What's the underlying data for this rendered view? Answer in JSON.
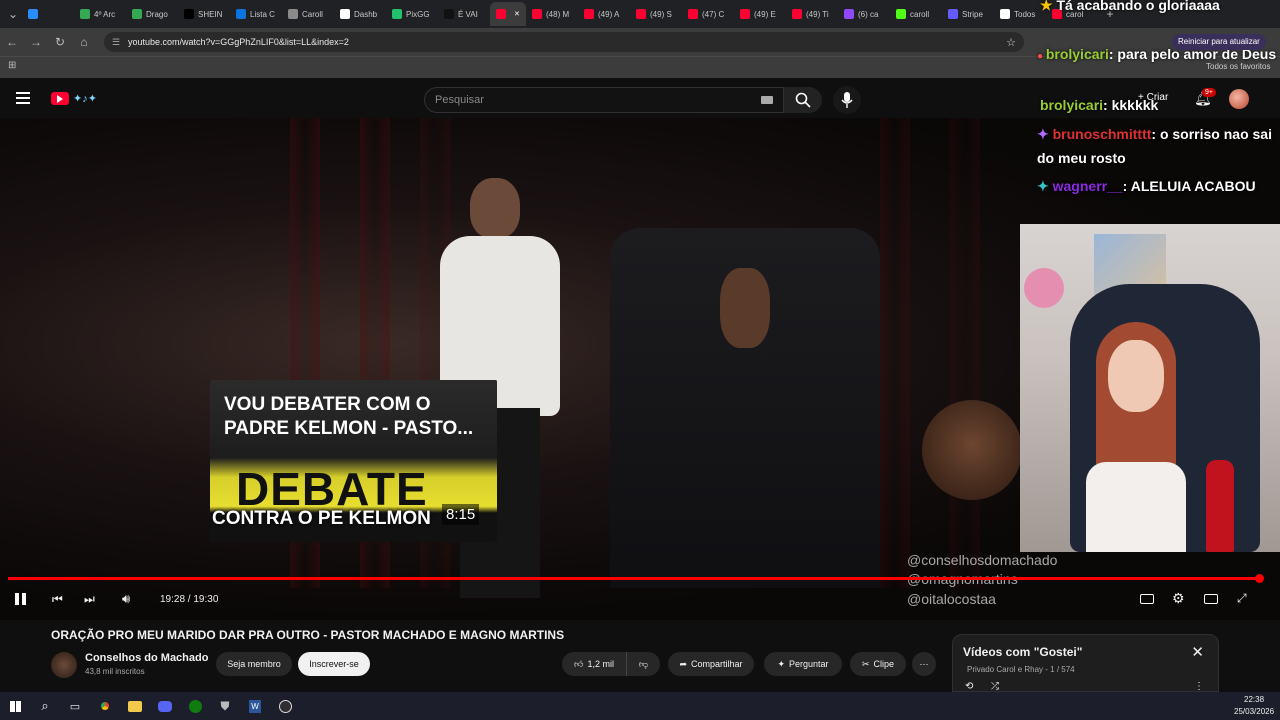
{
  "browser": {
    "tabs": [
      {
        "label": "",
        "color": "#2a8bff"
      },
      {
        "label": "4º Arc",
        "color": "#34a853"
      },
      {
        "label": "Drago",
        "color": "#34a853"
      },
      {
        "label": "SHEIN",
        "color": "#000000"
      },
      {
        "label": "Lista C",
        "color": "#0b74de"
      },
      {
        "label": "Caroll",
        "color": "#8a8a8a"
      },
      {
        "label": "Dashb",
        "color": "#ffffff"
      },
      {
        "label": "PixGG",
        "color": "#23c16b"
      },
      {
        "label": "É VAI",
        "color": "#111111"
      },
      {
        "label": "",
        "color": "#ff0033",
        "active": true
      },
      {
        "label": "(48) M",
        "color": "#ff0033"
      },
      {
        "label": "(49) A",
        "color": "#ff0033"
      },
      {
        "label": "(49) S",
        "color": "#ff0033"
      },
      {
        "label": "(47) C",
        "color": "#ff0033"
      },
      {
        "label": "(49) E",
        "color": "#ff0033"
      },
      {
        "label": "(49) Ti",
        "color": "#ff0033"
      },
      {
        "label": "(6) ca",
        "color": "#9146ff"
      },
      {
        "label": "caroll",
        "color": "#53fc18"
      },
      {
        "label": "Stripe",
        "color": "#635bff"
      },
      {
        "label": "Todos",
        "color": "#ffffff"
      },
      {
        "label": "carol",
        "color": "#ff0033"
      }
    ],
    "url": "youtube.com/watch?v=GGgPhZnLIF0&list=LL&index=2",
    "refresh_prompt": "Reiniciar para atualizar",
    "favorites_label": "Todos os favoritos"
  },
  "youtube": {
    "search_placeholder": "Pesquisar",
    "create_label": "Criar",
    "notif_count": "9+",
    "time": "19:28 / 19:30",
    "progress": 0.996,
    "title": "ORAÇÃO PRO MEU MARIDO DAR PRA OUTRO - PASTOR MACHADO E MAGNO MARTINS",
    "channel": "Conselhos do Machado",
    "subs": "43,8 mil inscritos",
    "member_btn": "Seja membro",
    "subscribe_btn": "Inscrever-se",
    "likes": "1,2 mil",
    "share": "Compartilhar",
    "ask": "Perguntar",
    "clip": "Clipe",
    "endcard": {
      "title_line1": "VOU DEBATER COM O",
      "title_line2": "PADRE KELMON - PASTO...",
      "big": "DEBATE",
      "sub": "CONTRA O PE KELMON",
      "duration": "8:15"
    },
    "watermarks": [
      "@conselhosdomachado",
      "@omagnomartins",
      "@oitalocostaa"
    ],
    "playlist": {
      "title": "Vídeos com \"Gostei\"",
      "meta": "Privado Carol e Rhay - 1 / 574"
    }
  },
  "chat": [
    {
      "user": "",
      "text": "Tá acabando o gloriaaaa",
      "color": "#ffffff"
    },
    {
      "user": "brolyicari",
      "text": ": para pelo amor de Deus",
      "color": "#9acd32"
    },
    {
      "user": "brolyicari",
      "text": ": kkkkkk",
      "color": "#9acd32"
    },
    {
      "user": "brunoschmitttt",
      "text": ": o sorriso nao sai do meu rosto",
      "color": "#e03131"
    },
    {
      "user": "wagnerr__",
      "text": ": ALELUIA ACABOU",
      "color": "#8a2be2"
    }
  ],
  "taskbar": {
    "time": "22:38",
    "date": "25/03/2026"
  }
}
